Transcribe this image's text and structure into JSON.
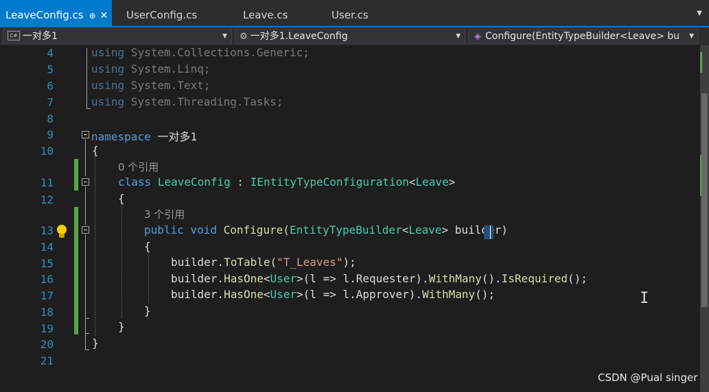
{
  "tabs": [
    {
      "label": "LeaveConfig.cs",
      "active": true,
      "pin": "⊕",
      "close": "✕"
    },
    {
      "label": "UserConfig.cs",
      "active": false
    },
    {
      "label": "Leave.cs",
      "active": false
    },
    {
      "label": "User.cs",
      "active": false
    }
  ],
  "nav": {
    "project": "一对多1",
    "class_path": "一对多1.LeaveConfig",
    "member": "Configure(EntityTypeBuilder<Leave> bu",
    "project_icon": "C#"
  },
  "line_numbers": [
    "4",
    "5",
    "6",
    "7",
    "8",
    "9",
    "10",
    "11",
    "12",
    "13",
    "14",
    "15",
    "16",
    "17",
    "18",
    "19",
    "20",
    "21"
  ],
  "code": {
    "using_kw": "using",
    "l4": " System.Collections.Generic;",
    "l5": " System.Linq;",
    "l6": " System.Text;",
    "l7": " System.Threading.Tasks;",
    "ns_kw": "namespace",
    "ns_name": " 一对多1",
    "open_brace": "{",
    "close_brace": "}",
    "ref0": "0 个引用",
    "class_kw": "class",
    "class_name": " LeaveConfig",
    "class_colon": " : ",
    "iface": "IEntityTypeConfiguration",
    "lt": "<",
    "gt": ">",
    "leave": "Leave",
    "ref3": "3 个引用",
    "public_kw": "public",
    "void_kw": " void",
    "method": " Configure",
    "paren_open": "(",
    "etb": "EntityTypeBuilder",
    "param": "> builder)",
    "builder": "builder.",
    "totable": "ToTable",
    "tstr": "\"T_Leaves\"",
    "end1": ");",
    "hasone": "HasOne",
    "user": "User",
    "lam1": ">(l => l.Requester).",
    "lam2": ">(l => l.Approver).",
    "withmany": "WithMany",
    "parens": "()",
    "dot": ".",
    "isreq": "IsRequired",
    "end2": "();",
    "semi": ";"
  },
  "watermark": "CSDN @Pual singer"
}
